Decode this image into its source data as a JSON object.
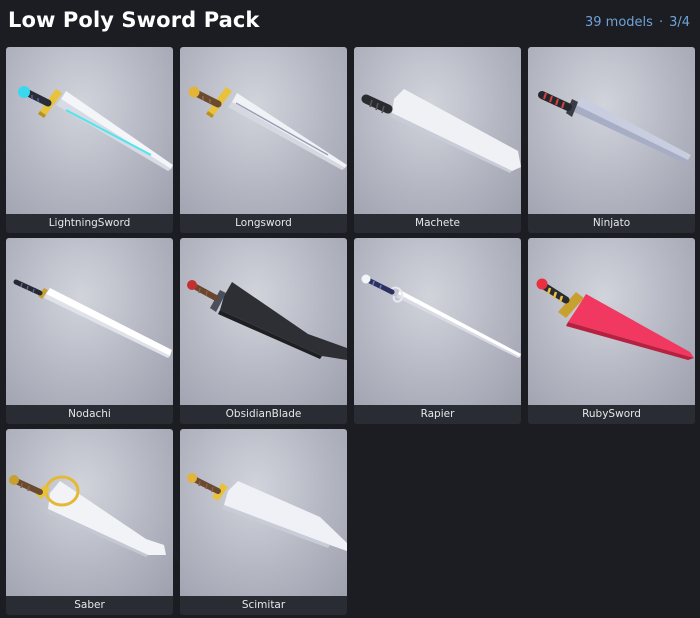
{
  "header": {
    "title": "Low Poly Sword Pack",
    "model_count": "39 models",
    "separator": "·",
    "page_indicator": "3/4"
  },
  "models": [
    {
      "label": "LightningSword"
    },
    {
      "label": "Longsword"
    },
    {
      "label": "Machete"
    },
    {
      "label": "Ninjato"
    },
    {
      "label": "Nodachi"
    },
    {
      "label": "ObsidianBlade"
    },
    {
      "label": "Rapier"
    },
    {
      "label": "RubySword"
    },
    {
      "label": "Saber"
    },
    {
      "label": "Scimitar"
    }
  ],
  "colors": {
    "background": "#1c1d22",
    "card": "#2a2c33",
    "accent": "#6fa2d8"
  }
}
